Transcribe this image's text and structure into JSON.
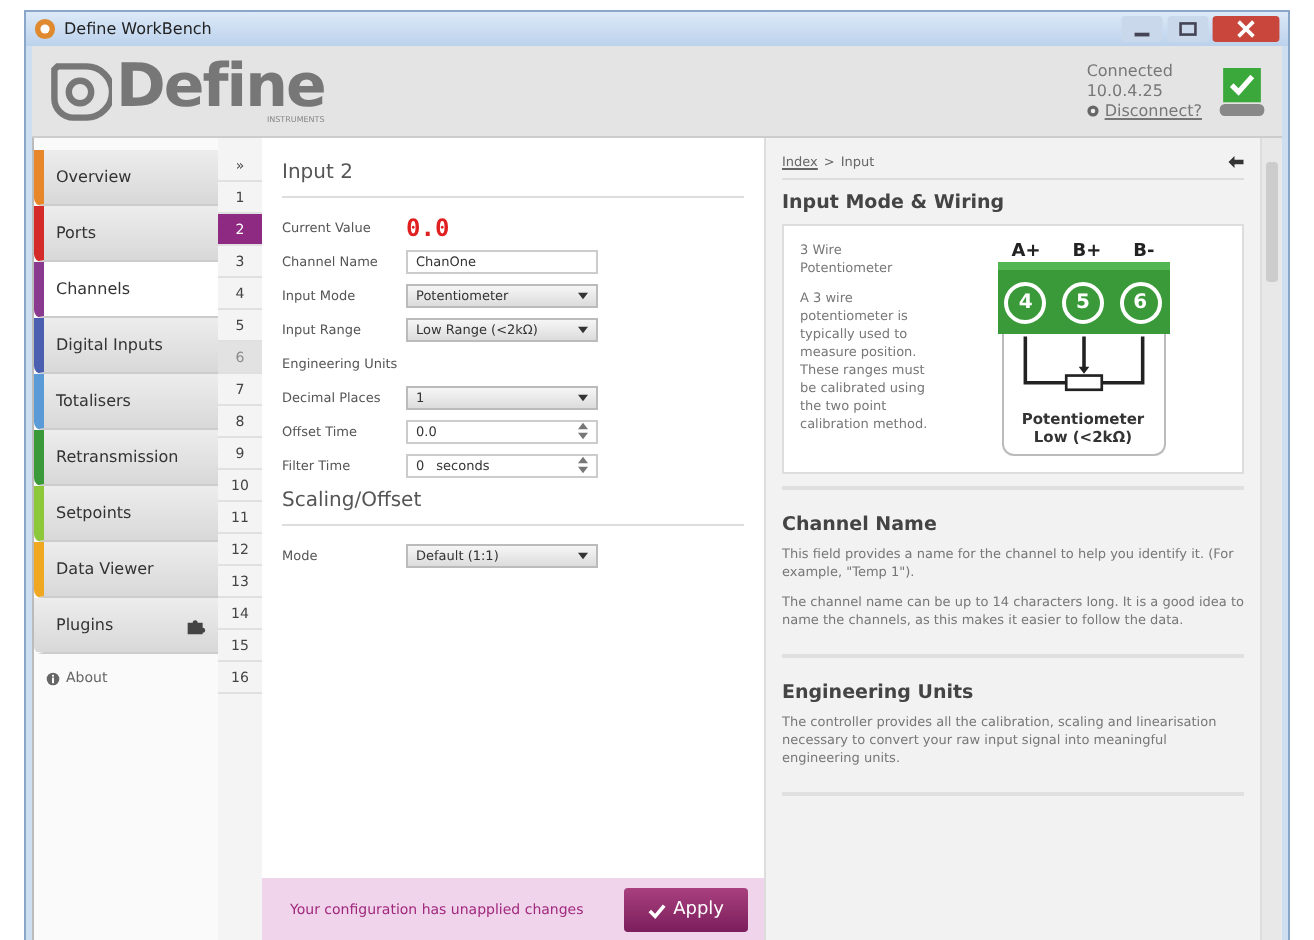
{
  "window": {
    "title": "Define WorkBench"
  },
  "header": {
    "logo": "Define",
    "logo_sub": "INSTRUMENTS",
    "status": "Connected",
    "address": "10.0.4.25",
    "disconnect_link": "Disconnect?",
    "connected": true
  },
  "nav": {
    "items": [
      {
        "label": "Overview",
        "color": "#e8862a",
        "selected": false
      },
      {
        "label": "Ports",
        "color": "#d42a2a",
        "selected": false
      },
      {
        "label": "Channels",
        "color": "#8a3a8e",
        "selected": true
      },
      {
        "label": "Digital Inputs",
        "color": "#4a5fb0",
        "selected": false
      },
      {
        "label": "Totalisers",
        "color": "#5a9ad6",
        "selected": false
      },
      {
        "label": "Retransmission",
        "color": "#3a9a3a",
        "selected": false
      },
      {
        "label": "Setpoints",
        "color": "#8cc83a",
        "selected": false
      },
      {
        "label": "Data Viewer",
        "color": "#f0a820",
        "selected": false
      },
      {
        "label": "Plugins",
        "selected": false
      }
    ],
    "about": "About"
  },
  "channels": {
    "collapse": "»",
    "items": [
      {
        "label": "1",
        "selected": false,
        "disabled": false
      },
      {
        "label": "2",
        "selected": true,
        "disabled": false
      },
      {
        "label": "3",
        "selected": false,
        "disabled": false
      },
      {
        "label": "4",
        "selected": false,
        "disabled": false
      },
      {
        "label": "5",
        "selected": false,
        "disabled": false
      },
      {
        "label": "6",
        "selected": false,
        "disabled": true
      },
      {
        "label": "7",
        "selected": false,
        "disabled": false
      },
      {
        "label": "8",
        "selected": false,
        "disabled": false
      },
      {
        "label": "9",
        "selected": false,
        "disabled": false
      },
      {
        "label": "10",
        "selected": false,
        "disabled": false
      },
      {
        "label": "11",
        "selected": false,
        "disabled": false
      },
      {
        "label": "12",
        "selected": false,
        "disabled": false
      },
      {
        "label": "13",
        "selected": false,
        "disabled": false
      },
      {
        "label": "14",
        "selected": false,
        "disabled": false
      },
      {
        "label": "15",
        "selected": false,
        "disabled": false
      },
      {
        "label": "16",
        "selected": false,
        "disabled": false
      }
    ]
  },
  "form": {
    "sections": [
      {
        "title": "Input 2",
        "fields": [
          {
            "kind": "reading",
            "label": "Current Value",
            "value": "0.0"
          },
          {
            "kind": "text",
            "label": "Channel Name",
            "value": "ChanOne"
          },
          {
            "kind": "select",
            "label": "Input Mode",
            "value": "Potentiometer"
          },
          {
            "kind": "select",
            "label": "Input Range",
            "value": "Low Range (<2kΩ)"
          },
          {
            "kind": "plain",
            "label": "Engineering Units"
          },
          {
            "kind": "select",
            "label": "Decimal Places",
            "value": "1"
          },
          {
            "kind": "spinner",
            "label": "Offset Time",
            "value": "0.0"
          },
          {
            "kind": "spinner",
            "label": "Filter Time",
            "value": "0",
            "unit": "seconds"
          }
        ]
      },
      {
        "title": "Scaling/Offset",
        "fields": [
          {
            "kind": "select",
            "label": "Mode",
            "value": "Default (1:1)"
          }
        ]
      }
    ]
  },
  "footer": {
    "message": "Your configuration has unapplied changes",
    "apply_button": "Apply"
  },
  "help": {
    "breadcrumb": {
      "link": "Index",
      "separator": ">",
      "current": "Input"
    },
    "sections": [
      {
        "kind": "diagram",
        "title": "Input Mode & Wiring",
        "subtitle": "3 Wire Potentiometer",
        "text": "A 3 wire potentiometer is typically used to measure position. These ranges must be calibrated using the two point calibration method.",
        "terminals": [
          {
            "label": "A+",
            "number": "4"
          },
          {
            "label": "B+",
            "number": "5"
          },
          {
            "label": "B-",
            "number": "6"
          }
        ],
        "caption": "Potentiometer Low (<2kΩ)"
      },
      {
        "kind": "text",
        "title": "Channel Name",
        "paragraphs": [
          "This field provides a name for the channel to help you identify it. (For example, \"Temp 1\").",
          "The channel name can be up to 14 characters long. It is a good idea to name the channels, as this makes it easier to follow the data."
        ]
      },
      {
        "kind": "text",
        "title": "Engineering Units",
        "paragraphs": [
          "The controller provides all the calibration, scaling and linearisation necessary to convert your raw input signal into meaningful engineering units."
        ]
      }
    ]
  }
}
